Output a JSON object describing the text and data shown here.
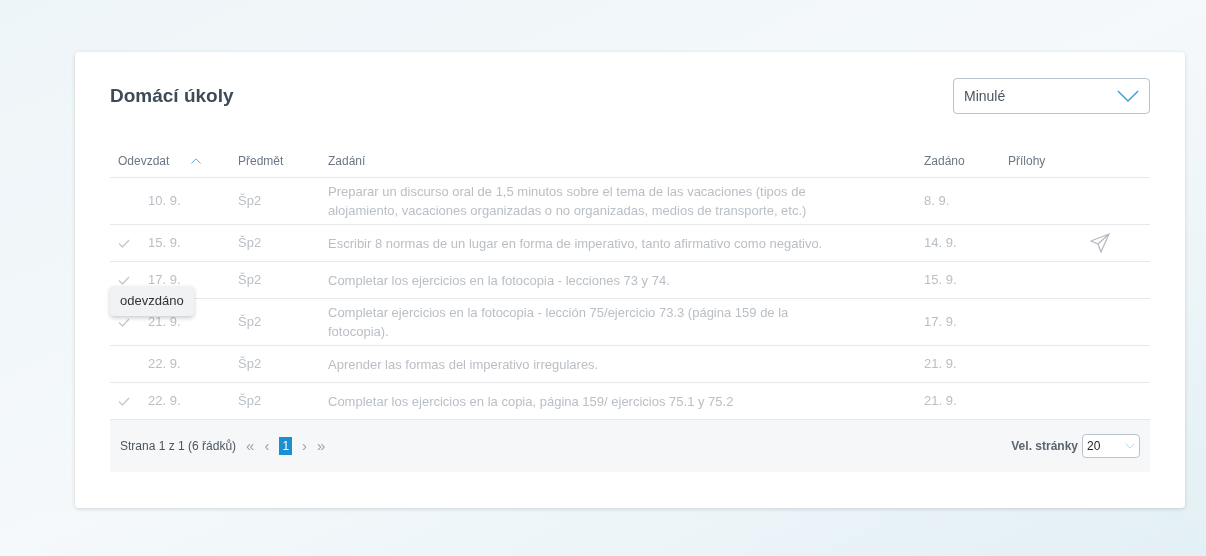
{
  "title": "Domácí úkoly",
  "filter": {
    "value": "Minulé"
  },
  "table": {
    "columns": [
      {
        "label": "Odevzdat",
        "sorted": true
      },
      {
        "label": "Předmět",
        "sorted": false
      },
      {
        "label": "Zadání",
        "sorted": false
      },
      {
        "label": "Zadáno",
        "sorted": false
      },
      {
        "label": "Přílohy",
        "sorted": false
      }
    ],
    "rows": [
      {
        "submitted": false,
        "due": "10. 9.",
        "subject": "Šp2",
        "task": "Preparar un discurso oral de 1,5 minutos sobre el tema de las vacaciones (tipos de alojamiento, vacaciones organizadas o no organizadas, medios de transporte, etc.)",
        "assigned": "8. 9.",
        "attachment": false
      },
      {
        "submitted": true,
        "due": "15. 9.",
        "subject": "Šp2",
        "task": "Escribir 8 normas de un lugar en forma de imperativo, tanto afirmativo como negativo.",
        "assigned": "14. 9.",
        "attachment": true
      },
      {
        "submitted": true,
        "due": "17. 9.",
        "subject": "Šp2",
        "task": "Completar los ejercicios en la fotocopia - lecciones 73 y 74.",
        "assigned": "15. 9.",
        "attachment": false
      },
      {
        "submitted": true,
        "due": "21. 9.",
        "subject": "Šp2",
        "task": "Completar ejercicios en la fotocopia - lección 75/ejercicio 73.3 (página 159 de la fotocopia).",
        "assigned": "17. 9.",
        "attachment": false
      },
      {
        "submitted": false,
        "due": "22. 9.",
        "subject": "Šp2",
        "task": "Aprender las formas del imperativo irregulares.",
        "assigned": "21. 9.",
        "attachment": false
      },
      {
        "submitted": true,
        "due": "22. 9.",
        "subject": "Šp2",
        "task": "Completar los ejercicios en la copia, página 159/ ejercicios 75.1 y 75.2",
        "assigned": "21. 9.",
        "attachment": false
      }
    ]
  },
  "tooltip": "odevzdáno",
  "pager": {
    "summary": "Strana 1 z 1 (6 řádků)",
    "first": "«",
    "previous": "‹",
    "pages": [
      {
        "label": "1",
        "selected": true
      }
    ],
    "next": "›",
    "last": "»",
    "page_size_label": "Vel. stránky",
    "page_size": "20"
  }
}
